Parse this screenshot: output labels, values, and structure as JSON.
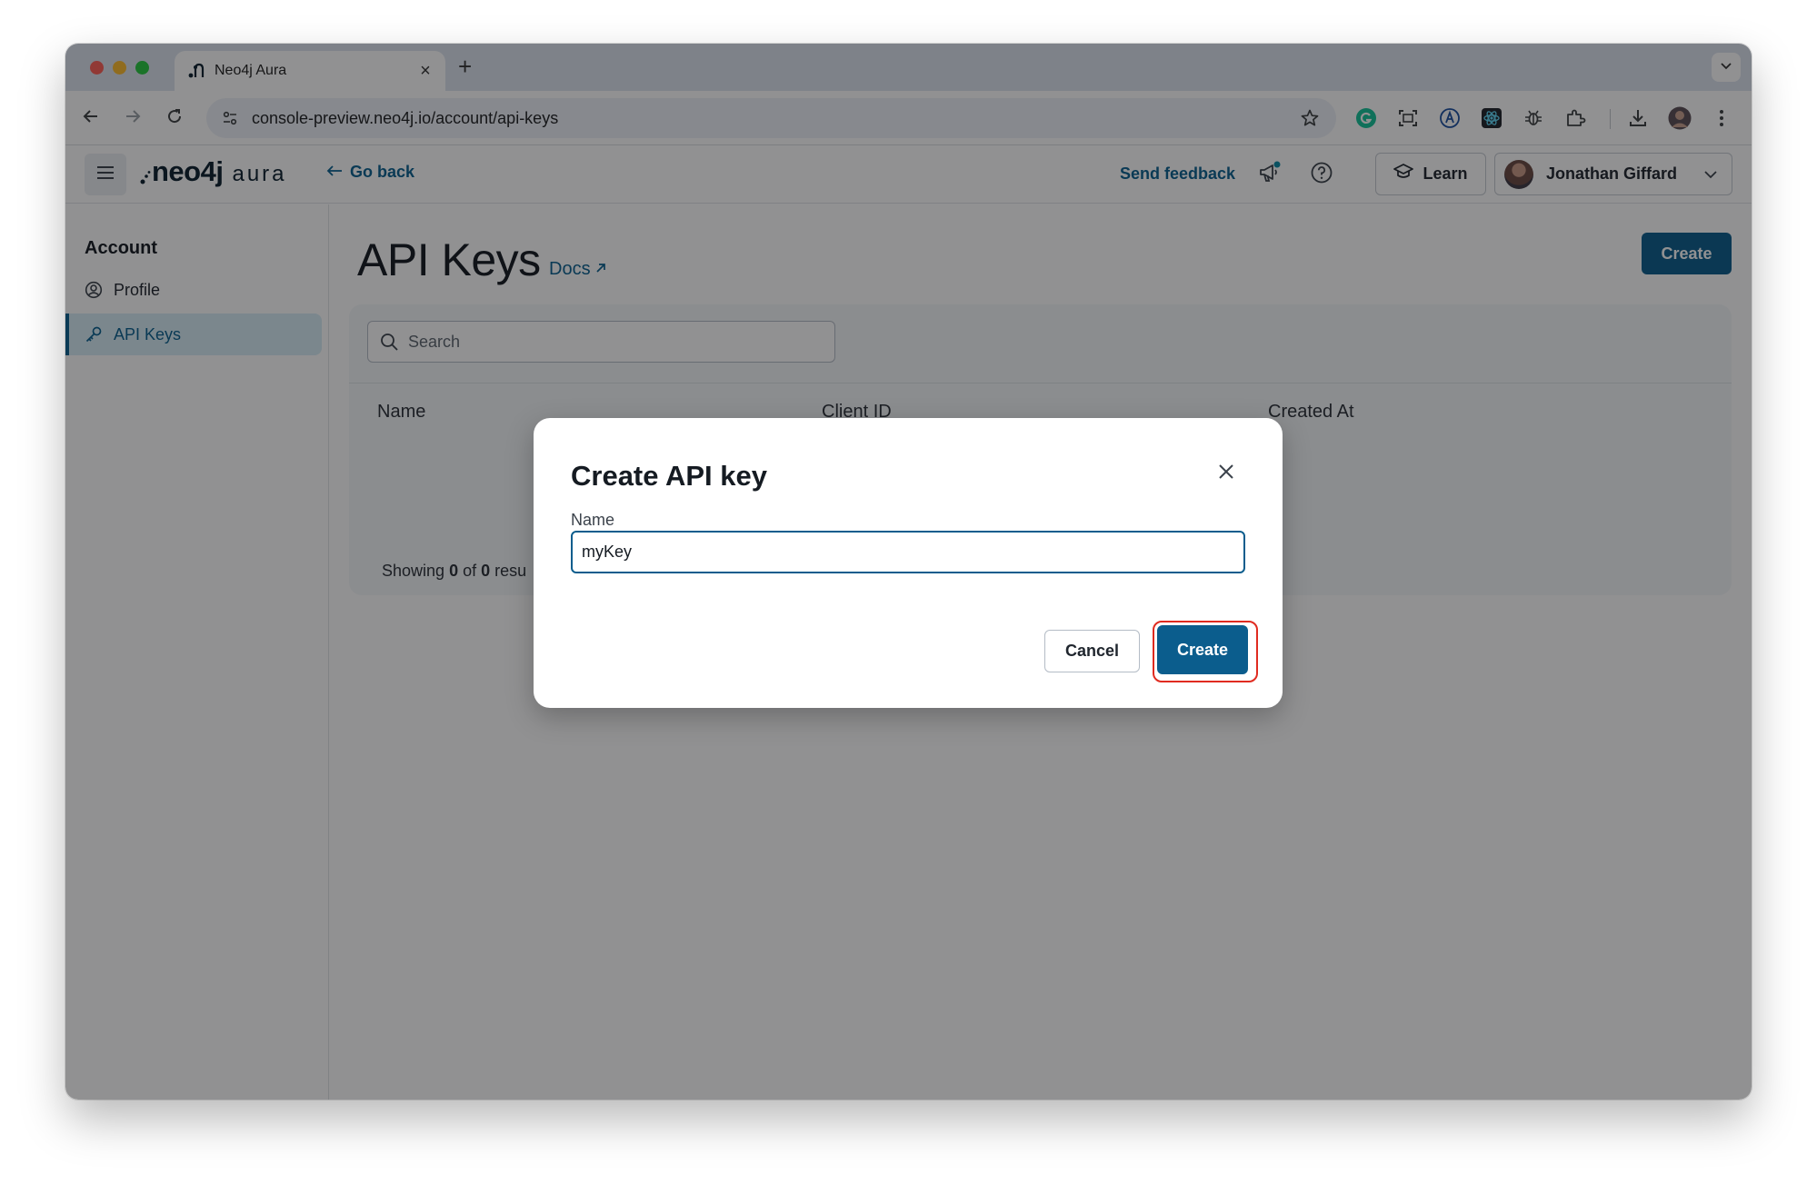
{
  "browser": {
    "tab_title": "Neo4j Aura",
    "new_tab": "+",
    "url": "console-preview.neo4j.io/account/api-keys"
  },
  "header": {
    "logo_neo": "neo4j",
    "logo_aura": "aura",
    "go_back": "Go back",
    "send_feedback": "Send feedback",
    "learn": "Learn",
    "user_name": "Jonathan Giffard"
  },
  "sidebar": {
    "heading": "Account",
    "items": [
      {
        "label": "Profile",
        "icon": "user-circle-icon",
        "active": false
      },
      {
        "label": "API Keys",
        "icon": "key-icon",
        "active": true
      }
    ]
  },
  "main": {
    "title": "API Keys",
    "docs": "Docs",
    "create": "Create",
    "search_placeholder": "Search",
    "columns": [
      "Name",
      "Client ID",
      "Created At"
    ],
    "showing_prefix": "Showing ",
    "showing_count": "0",
    "showing_of": " of ",
    "showing_total": "0",
    "showing_suffix": " resu"
  },
  "modal": {
    "title": "Create API key",
    "field_label": "Name",
    "field_value": "myKey",
    "cancel": "Cancel",
    "create": "Create"
  },
  "colors": {
    "brand": "#0b5d8d",
    "link": "#0a6190",
    "highlight_ring": "#e02b20",
    "active_nav_bg": "#d7edf6"
  }
}
